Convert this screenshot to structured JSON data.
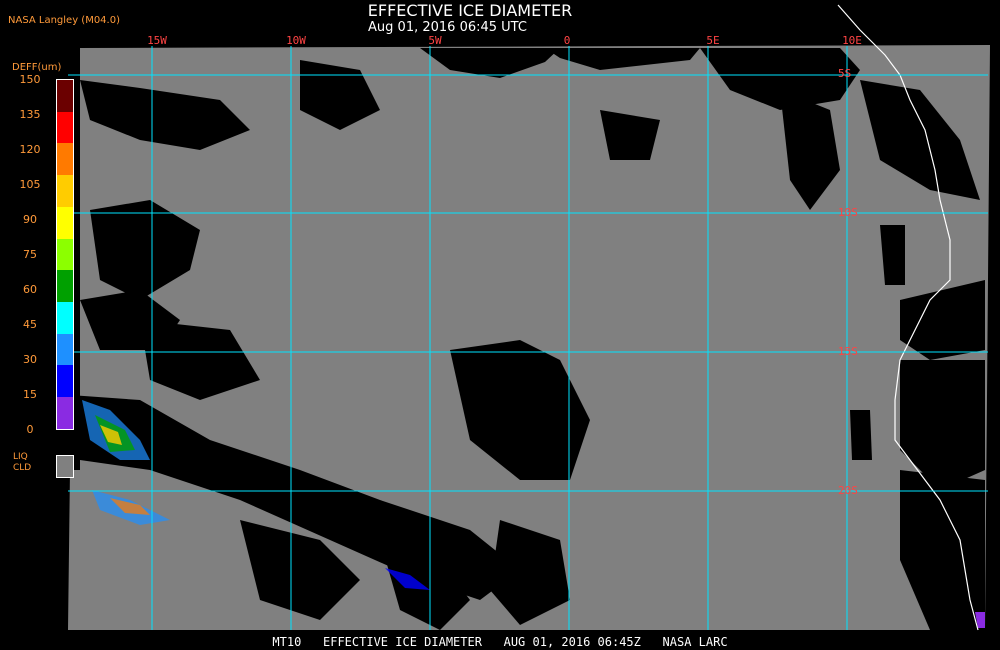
{
  "title": "EFFECTIVE ICE DIAMETER",
  "subtitle": "Aug 01, 2016 06:45 UTC",
  "source": "NASA Langley (M04.0)",
  "legend": {
    "title": "DEFF(um)",
    "ticks": [
      "150",
      "135",
      "120",
      "105",
      "90",
      "75",
      "60",
      "45",
      "30",
      "15",
      "0"
    ],
    "colors": [
      "#6b0000",
      "#ff0000",
      "#ff7a00",
      "#ffcc00",
      "#ffff00",
      "#8cff00",
      "#00a000",
      "#00ffff",
      "#1e90ff",
      "#0000ff",
      "#8a2be2"
    ],
    "liq_label_1": "LIQ",
    "liq_label_2": "CLD",
    "liq_color": "#808080"
  },
  "map": {
    "land_color": "#808080",
    "grid_color": "#00e5ff",
    "lon_labels": [
      "15W",
      "10W",
      "5W",
      "0",
      "5E",
      "10E"
    ],
    "lat_labels": [
      "5S",
      "10S",
      "15S",
      "20S"
    ]
  },
  "footer": "MT10   EFFECTIVE ICE DIAMETER   AUG 01, 2016 06:45Z   NASA LARC"
}
